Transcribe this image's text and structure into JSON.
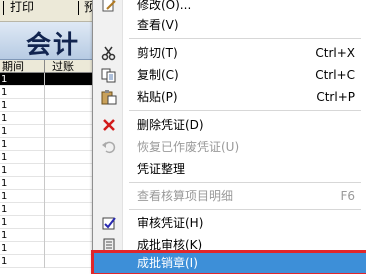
{
  "toolbar": {
    "items": [
      "打印",
      "预"
    ]
  },
  "banner": {
    "title": "会计"
  },
  "grid": {
    "headers": [
      "期间",
      "过账"
    ],
    "rows": [
      "1",
      "1",
      "1",
      "1",
      "1",
      "1",
      "1",
      "1",
      "1",
      "1",
      "1",
      "1",
      "1",
      "1",
      "1"
    ]
  },
  "menu": {
    "items": [
      {
        "label": "修改(O)...",
        "shortcut": "",
        "icon": "edit-icon",
        "enabled": true
      },
      {
        "label": "查看(V)",
        "shortcut": "",
        "icon": "",
        "enabled": true
      },
      {
        "label": "剪切(T)",
        "shortcut": "Ctrl+X",
        "icon": "scissors-icon",
        "enabled": true
      },
      {
        "label": "复制(C)",
        "shortcut": "Ctrl+C",
        "icon": "copy-icon",
        "enabled": true
      },
      {
        "label": "粘贴(P)",
        "shortcut": "Ctrl+P",
        "icon": "paste-icon",
        "enabled": true
      },
      {
        "label": "删除凭证(D)",
        "shortcut": "",
        "icon": "delete-x-icon",
        "enabled": true
      },
      {
        "label": "恢复已作废凭证(U)",
        "shortcut": "",
        "icon": "undo-icon",
        "enabled": false
      },
      {
        "label": "凭证整理",
        "shortcut": "",
        "icon": "",
        "enabled": true
      },
      {
        "label": "查看核算项目明细",
        "shortcut": "F6",
        "icon": "",
        "enabled": false
      },
      {
        "label": "审核凭证(H)",
        "shortcut": "",
        "icon": "approve-icon",
        "enabled": true
      },
      {
        "label": "成批审核(K)",
        "shortcut": "",
        "icon": "batch-approve-icon",
        "enabled": true
      },
      {
        "label": "成批销章(I)",
        "shortcut": "",
        "icon": "",
        "enabled": true
      }
    ],
    "highlighted_index": 11
  },
  "colors": {
    "highlight": "#3d8fd8",
    "annotation_red": "#e0262a"
  }
}
